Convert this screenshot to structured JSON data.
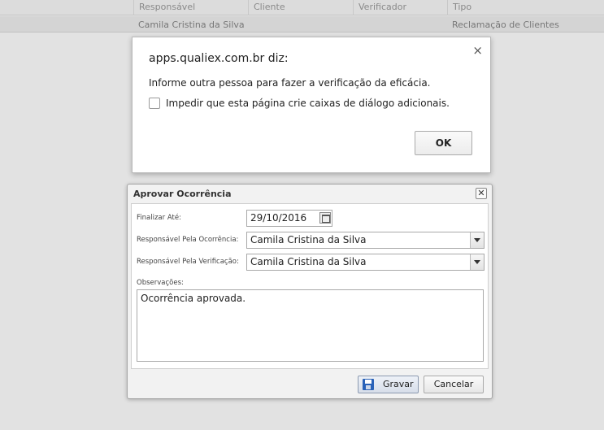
{
  "table": {
    "columns": [
      "Responsável",
      "Cliente",
      "Verificador",
      "Tipo"
    ],
    "row": {
      "responsavel": "Camila Cristina da Silva",
      "tipo": "Reclamação de Clientes"
    }
  },
  "alert": {
    "title": "apps.qualiex.com.br diz:",
    "message": "Informe outra pessoa para fazer a verificação da eficácia.",
    "checkbox_label": "Impedir que esta página crie caixas de diálogo adicionais.",
    "ok_label": "OK",
    "close_glyph": "×"
  },
  "dialog": {
    "title": "Aprovar Ocorrência",
    "close_glyph": "✕",
    "fields": {
      "finalizar_label": "Finalizar Até:",
      "finalizar_value": "29/10/2016",
      "resp_ocorrencia_label": "Responsável Pela Ocorrência:",
      "resp_ocorrencia_value": "Camila Cristina da Silva",
      "resp_verificacao_label": "Responsável Pela Verificação:",
      "resp_verificacao_value": "Camila Cristina da Silva",
      "observacoes_label": "Observações:",
      "observacoes_value": "Ocorrência aprovada."
    },
    "buttons": {
      "gravar": "Gravar",
      "cancelar": "Cancelar"
    }
  }
}
